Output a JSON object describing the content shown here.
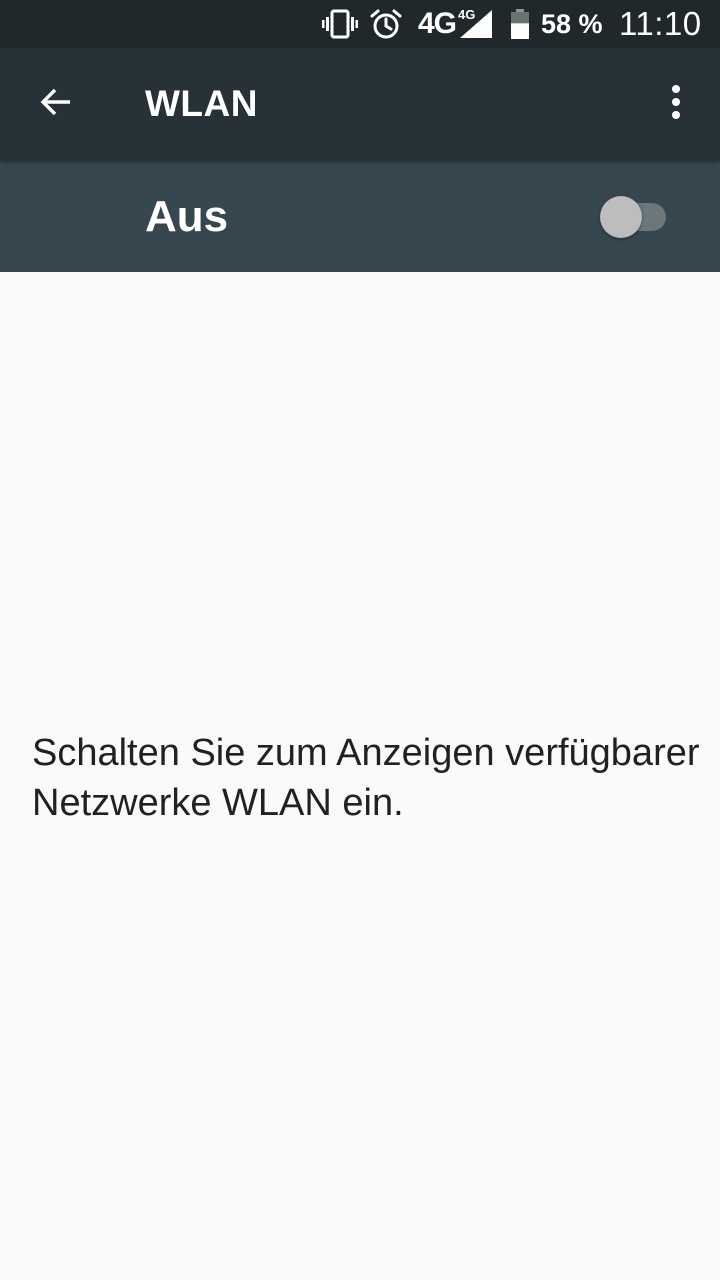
{
  "status_bar": {
    "network": "4G",
    "network_secondary": "4G",
    "battery_percent": "58 %",
    "battery_level": 0.58,
    "time": "11:10",
    "icons": [
      "vibrate-icon",
      "alarm-icon",
      "signal-icon",
      "battery-icon"
    ]
  },
  "toolbar": {
    "title": "WLAN",
    "back_icon": "arrow-left-icon",
    "overflow_icon": "more-vert-icon"
  },
  "wifi_switch": {
    "label": "Aus",
    "checked": false
  },
  "content": {
    "empty_message": "Schalten Sie zum Anzeigen verfügbarer Netzwerke WLAN ein."
  },
  "colors": {
    "status_bar": "#20282c",
    "toolbar": "#263238",
    "switch_bar": "#37474f",
    "background": "#fafafa",
    "text_primary": "#212121"
  }
}
